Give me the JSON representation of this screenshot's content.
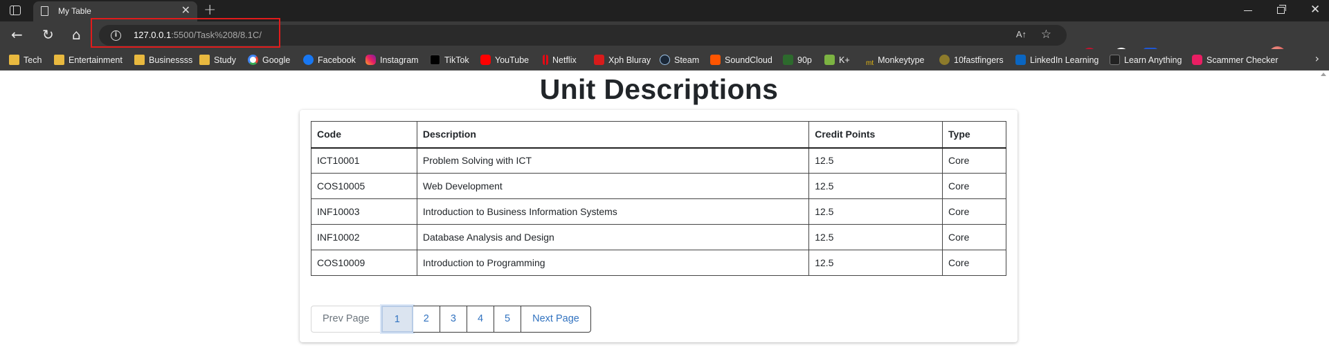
{
  "browser": {
    "tab_title": "My Table",
    "url_host": "127.0.0.1",
    "url_path": ":5500/Task%208/8.1C/",
    "read_aloud_label": "A↑"
  },
  "bookmarks": [
    {
      "label": "Tech",
      "icon": "folder-icon"
    },
    {
      "label": "Entertainment",
      "icon": "folder-icon"
    },
    {
      "label": "Businessss",
      "icon": "folder-icon"
    },
    {
      "label": "Study",
      "icon": "folder-icon"
    },
    {
      "label": "Google",
      "icon": "google-icon"
    },
    {
      "label": "Facebook",
      "icon": "facebook-icon"
    },
    {
      "label": "Instagram",
      "icon": "instagram-icon"
    },
    {
      "label": "TikTok",
      "icon": "tiktok-icon"
    },
    {
      "label": "YouTube",
      "icon": "youtube-icon"
    },
    {
      "label": "Netflix",
      "icon": "netflix-icon"
    },
    {
      "label": "Xph Bluray",
      "icon": "xph-icon"
    },
    {
      "label": "Steam",
      "icon": "steam-icon"
    },
    {
      "label": "SoundCloud",
      "icon": "soundcloud-icon"
    },
    {
      "label": "90p",
      "icon": "90p-icon"
    },
    {
      "label": "K+",
      "icon": "kplus-icon"
    },
    {
      "label": "Monkeytype",
      "icon": "monkeytype-icon"
    },
    {
      "label": "10fastfingers",
      "icon": "10fastfingers-icon"
    },
    {
      "label": "LinkedIn Learning",
      "icon": "linkedin-icon"
    },
    {
      "label": "Learn Anything",
      "icon": "learn-anything-icon"
    },
    {
      "label": "Scammer Checker",
      "icon": "scammer-checker-icon"
    }
  ],
  "page": {
    "title": "Unit Descriptions",
    "table": {
      "headers": [
        "Code",
        "Description",
        "Credit Points",
        "Type"
      ],
      "rows": [
        [
          "ICT10001",
          "Problem Solving with ICT",
          "12.5",
          "Core"
        ],
        [
          "COS10005",
          "Web Development",
          "12.5",
          "Core"
        ],
        [
          "INF10003",
          "Introduction to Business Information Systems",
          "12.5",
          "Core"
        ],
        [
          "INF10002",
          "Database Analysis and Design",
          "12.5",
          "Core"
        ],
        [
          "COS10009",
          "Introduction to Programming",
          "12.5",
          "Core"
        ]
      ]
    },
    "pagination": {
      "prev_label": "Prev Page",
      "pages": [
        "1",
        "2",
        "3",
        "4",
        "5"
      ],
      "active_page": "1",
      "next_label": "Next Page"
    }
  },
  "colors": {
    "highlight_box": "#e21b1b",
    "link": "#3273c0",
    "active_page_bg": "#dbe4f0"
  }
}
